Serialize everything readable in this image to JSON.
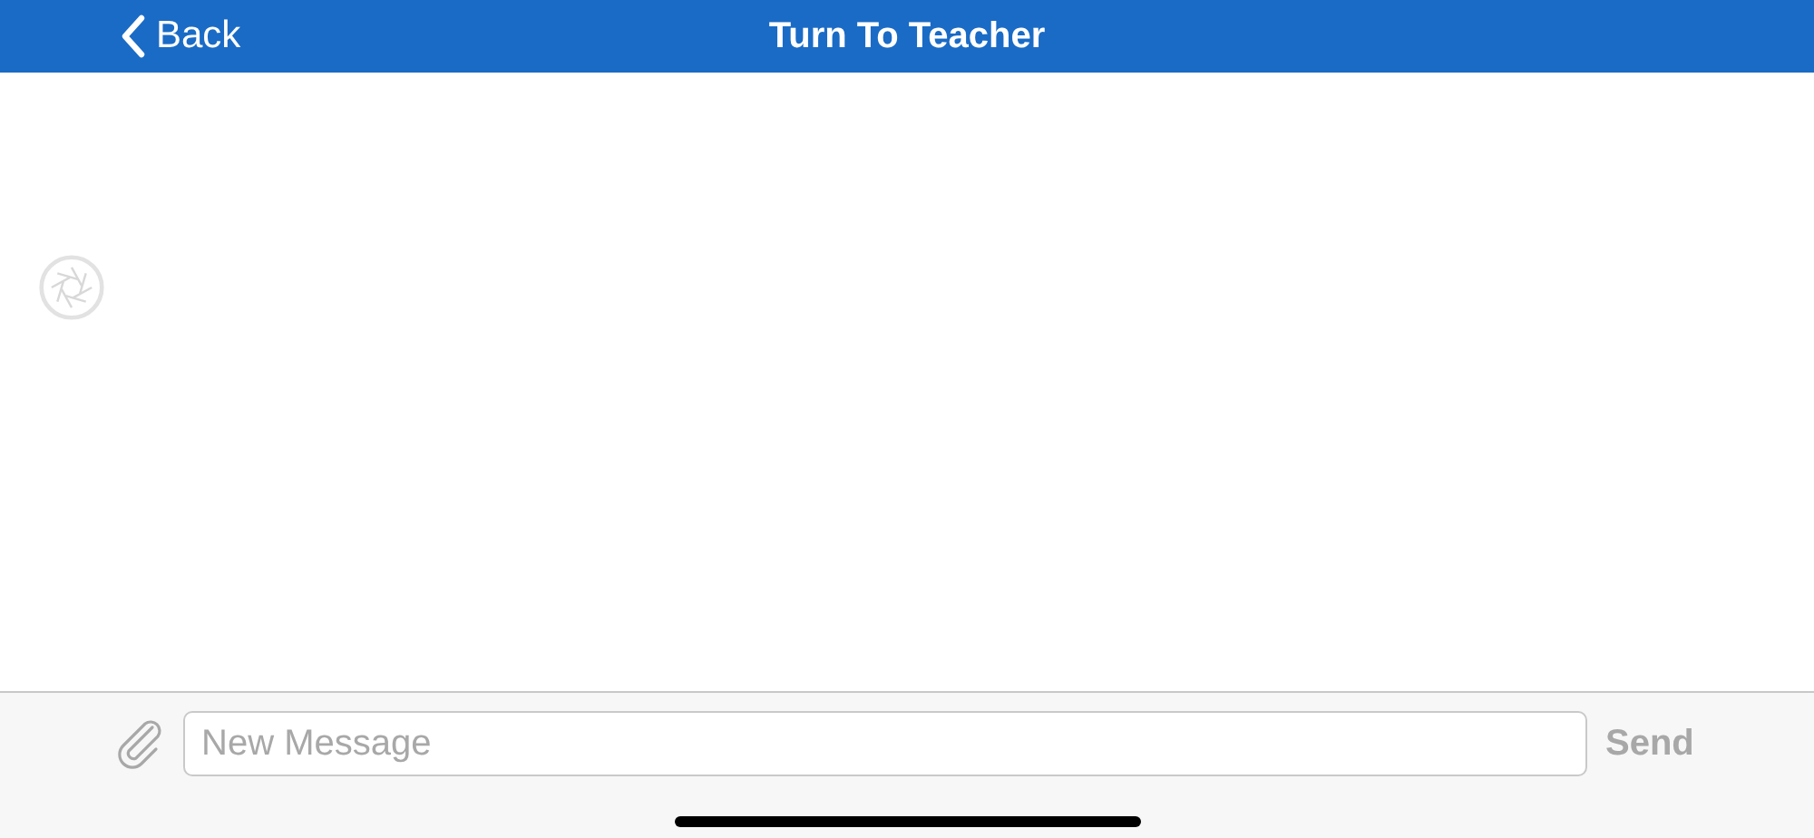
{
  "nav_bar": {
    "back_label": "Back",
    "title": "Turn To Teacher"
  },
  "composer": {
    "placeholder": "New Message",
    "send": {
      "label": "Send",
      "disabled": true
    }
  }
}
